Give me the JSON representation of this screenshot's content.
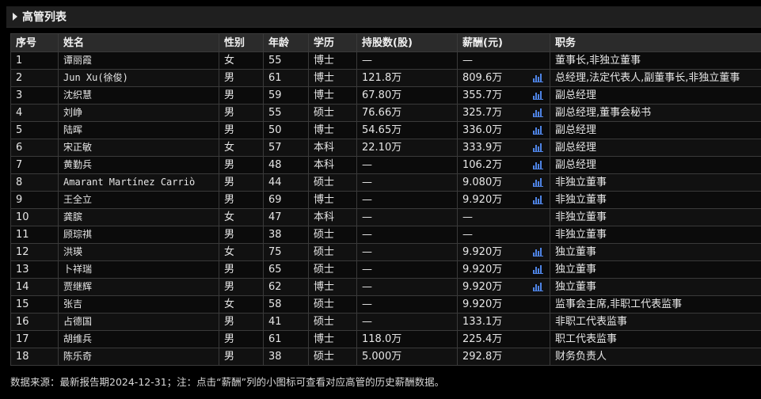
{
  "section_title": "高管列表",
  "columns": [
    "序号",
    "姓名",
    "性别",
    "年龄",
    "学历",
    "持股数(股)",
    "薪酬(元)",
    "职务"
  ],
  "rows": [
    {
      "no": "1",
      "name": "谭丽霞",
      "gender": "女",
      "age": "55",
      "edu": "博士",
      "shares": "—",
      "salary": "—",
      "chart": false,
      "title": "董事长,非独立董事"
    },
    {
      "no": "2",
      "name": "Jun Xu(徐俊)",
      "gender": "男",
      "age": "61",
      "edu": "博士",
      "shares": "121.8万",
      "salary": "809.6万",
      "chart": true,
      "title": "总经理,法定代表人,副董事长,非独立董事"
    },
    {
      "no": "3",
      "name": "沈织慧",
      "gender": "男",
      "age": "59",
      "edu": "博士",
      "shares": "67.80万",
      "salary": "355.7万",
      "chart": true,
      "title": "副总经理"
    },
    {
      "no": "4",
      "name": "刘峥",
      "gender": "男",
      "age": "55",
      "edu": "硕士",
      "shares": "76.66万",
      "salary": "325.7万",
      "chart": true,
      "title": "副总经理,董事会秘书"
    },
    {
      "no": "5",
      "name": "陆晖",
      "gender": "男",
      "age": "50",
      "edu": "博士",
      "shares": "54.65万",
      "salary": "336.0万",
      "chart": true,
      "title": "副总经理"
    },
    {
      "no": "6",
      "name": "宋正敏",
      "gender": "女",
      "age": "57",
      "edu": "本科",
      "shares": "22.10万",
      "salary": "333.9万",
      "chart": true,
      "title": "副总经理"
    },
    {
      "no": "7",
      "name": "黄勤兵",
      "gender": "男",
      "age": "48",
      "edu": "本科",
      "shares": "—",
      "salary": "106.2万",
      "chart": true,
      "title": "副总经理"
    },
    {
      "no": "8",
      "name": "Amarant Martínez Carriò",
      "gender": "男",
      "age": "44",
      "edu": "硕士",
      "shares": "—",
      "salary": "9.080万",
      "chart": true,
      "title": "非独立董事"
    },
    {
      "no": "9",
      "name": "王全立",
      "gender": "男",
      "age": "69",
      "edu": "博士",
      "shares": "—",
      "salary": "9.920万",
      "chart": true,
      "title": "非独立董事"
    },
    {
      "no": "10",
      "name": "龚膑",
      "gender": "女",
      "age": "47",
      "edu": "本科",
      "shares": "—",
      "salary": "—",
      "chart": false,
      "title": "非独立董事"
    },
    {
      "no": "11",
      "name": "顾琮祺",
      "gender": "男",
      "age": "38",
      "edu": "硕士",
      "shares": "—",
      "salary": "—",
      "chart": false,
      "title": "非独立董事"
    },
    {
      "no": "12",
      "name": "洪瑛",
      "gender": "女",
      "age": "75",
      "edu": "硕士",
      "shares": "—",
      "salary": "9.920万",
      "chart": true,
      "title": "独立董事"
    },
    {
      "no": "13",
      "name": "卜祥瑞",
      "gender": "男",
      "age": "65",
      "edu": "硕士",
      "shares": "—",
      "salary": "9.920万",
      "chart": true,
      "title": "独立董事"
    },
    {
      "no": "14",
      "name": "贾继辉",
      "gender": "男",
      "age": "62",
      "edu": "博士",
      "shares": "—",
      "salary": "9.920万",
      "chart": true,
      "title": "独立董事"
    },
    {
      "no": "15",
      "name": "张吉",
      "gender": "女",
      "age": "58",
      "edu": "硕士",
      "shares": "—",
      "salary": "9.920万",
      "chart": false,
      "title": "监事会主席,非职工代表监事"
    },
    {
      "no": "16",
      "name": "占德国",
      "gender": "男",
      "age": "41",
      "edu": "硕士",
      "shares": "—",
      "salary": "133.1万",
      "chart": false,
      "title": "非职工代表监事"
    },
    {
      "no": "17",
      "name": "胡维兵",
      "gender": "男",
      "age": "61",
      "edu": "博士",
      "shares": "118.0万",
      "salary": "225.4万",
      "chart": false,
      "title": "职工代表监事"
    },
    {
      "no": "18",
      "name": "陈乐奇",
      "gender": "男",
      "age": "38",
      "edu": "硕士",
      "shares": "5.000万",
      "salary": "292.8万",
      "chart": false,
      "title": "财务负责人"
    }
  ],
  "footnote": "数据来源：最新报告期2024-12-31；注：点击“薪酬”列的小图标可查看对应高管的历史薪酬数据。",
  "colors": {
    "accent": "#4e84e6",
    "header_bg": "#2b2b2b",
    "border": "#3a3a3a"
  }
}
